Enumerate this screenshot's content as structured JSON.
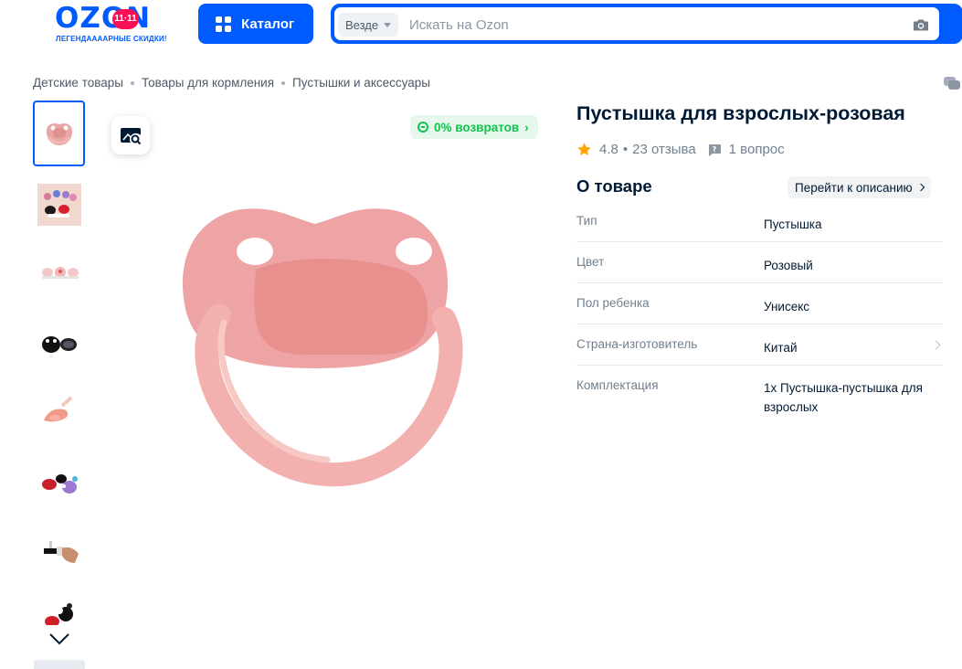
{
  "header": {
    "logo_text": "OZON",
    "logo_badge": "11·11",
    "logo_tagline": "ЛЕГЕНДААААРНЫЕ СКИДКИ!",
    "catalog_label": "Каталог",
    "search_scope": "Везде",
    "search_placeholder": "Искать на Ozon",
    "search_value": "",
    "brand_color": "#005bff",
    "badge_color": "#f91155"
  },
  "breadcrumb": [
    "Детские товары",
    "Товары для кормления",
    "Пустышки и аксессуары"
  ],
  "gallery": {
    "thumbnails": [
      {
        "name": "pink-pacifier",
        "active": true
      },
      {
        "name": "pacifier-set-colored",
        "active": false
      },
      {
        "name": "pacifier-pair-white",
        "active": false
      },
      {
        "name": "black-pacifiers",
        "active": false
      },
      {
        "name": "pacifier-side-view",
        "active": false
      },
      {
        "name": "pacifiers-red-purple",
        "active": false
      },
      {
        "name": "pacifier-in-hand",
        "active": false
      },
      {
        "name": "pacifiers-red-black",
        "active": false
      }
    ],
    "returns_badge": "0% возвратов",
    "returns_color": "#10c44c"
  },
  "product": {
    "title": "Пустышка для взрослых-розовая",
    "rating": "4.8",
    "reviews": "23 отзыва",
    "separator": "•",
    "questions": "1 вопрос",
    "star_color": "#ffa800"
  },
  "about": {
    "title": "О товаре",
    "goto_label": "Перейти к описанию",
    "specs": [
      {
        "name": "Тип",
        "value": "Пустышка"
      },
      {
        "name": "Цвет",
        "value": "Розовый"
      },
      {
        "name": "Пол ребенка",
        "value": "Унисекс"
      },
      {
        "name": "Страна-изготовитель",
        "value": "Китай"
      },
      {
        "name": "Комплектация",
        "value": "1х Пустышка-пустышка для взрослых"
      }
    ]
  }
}
